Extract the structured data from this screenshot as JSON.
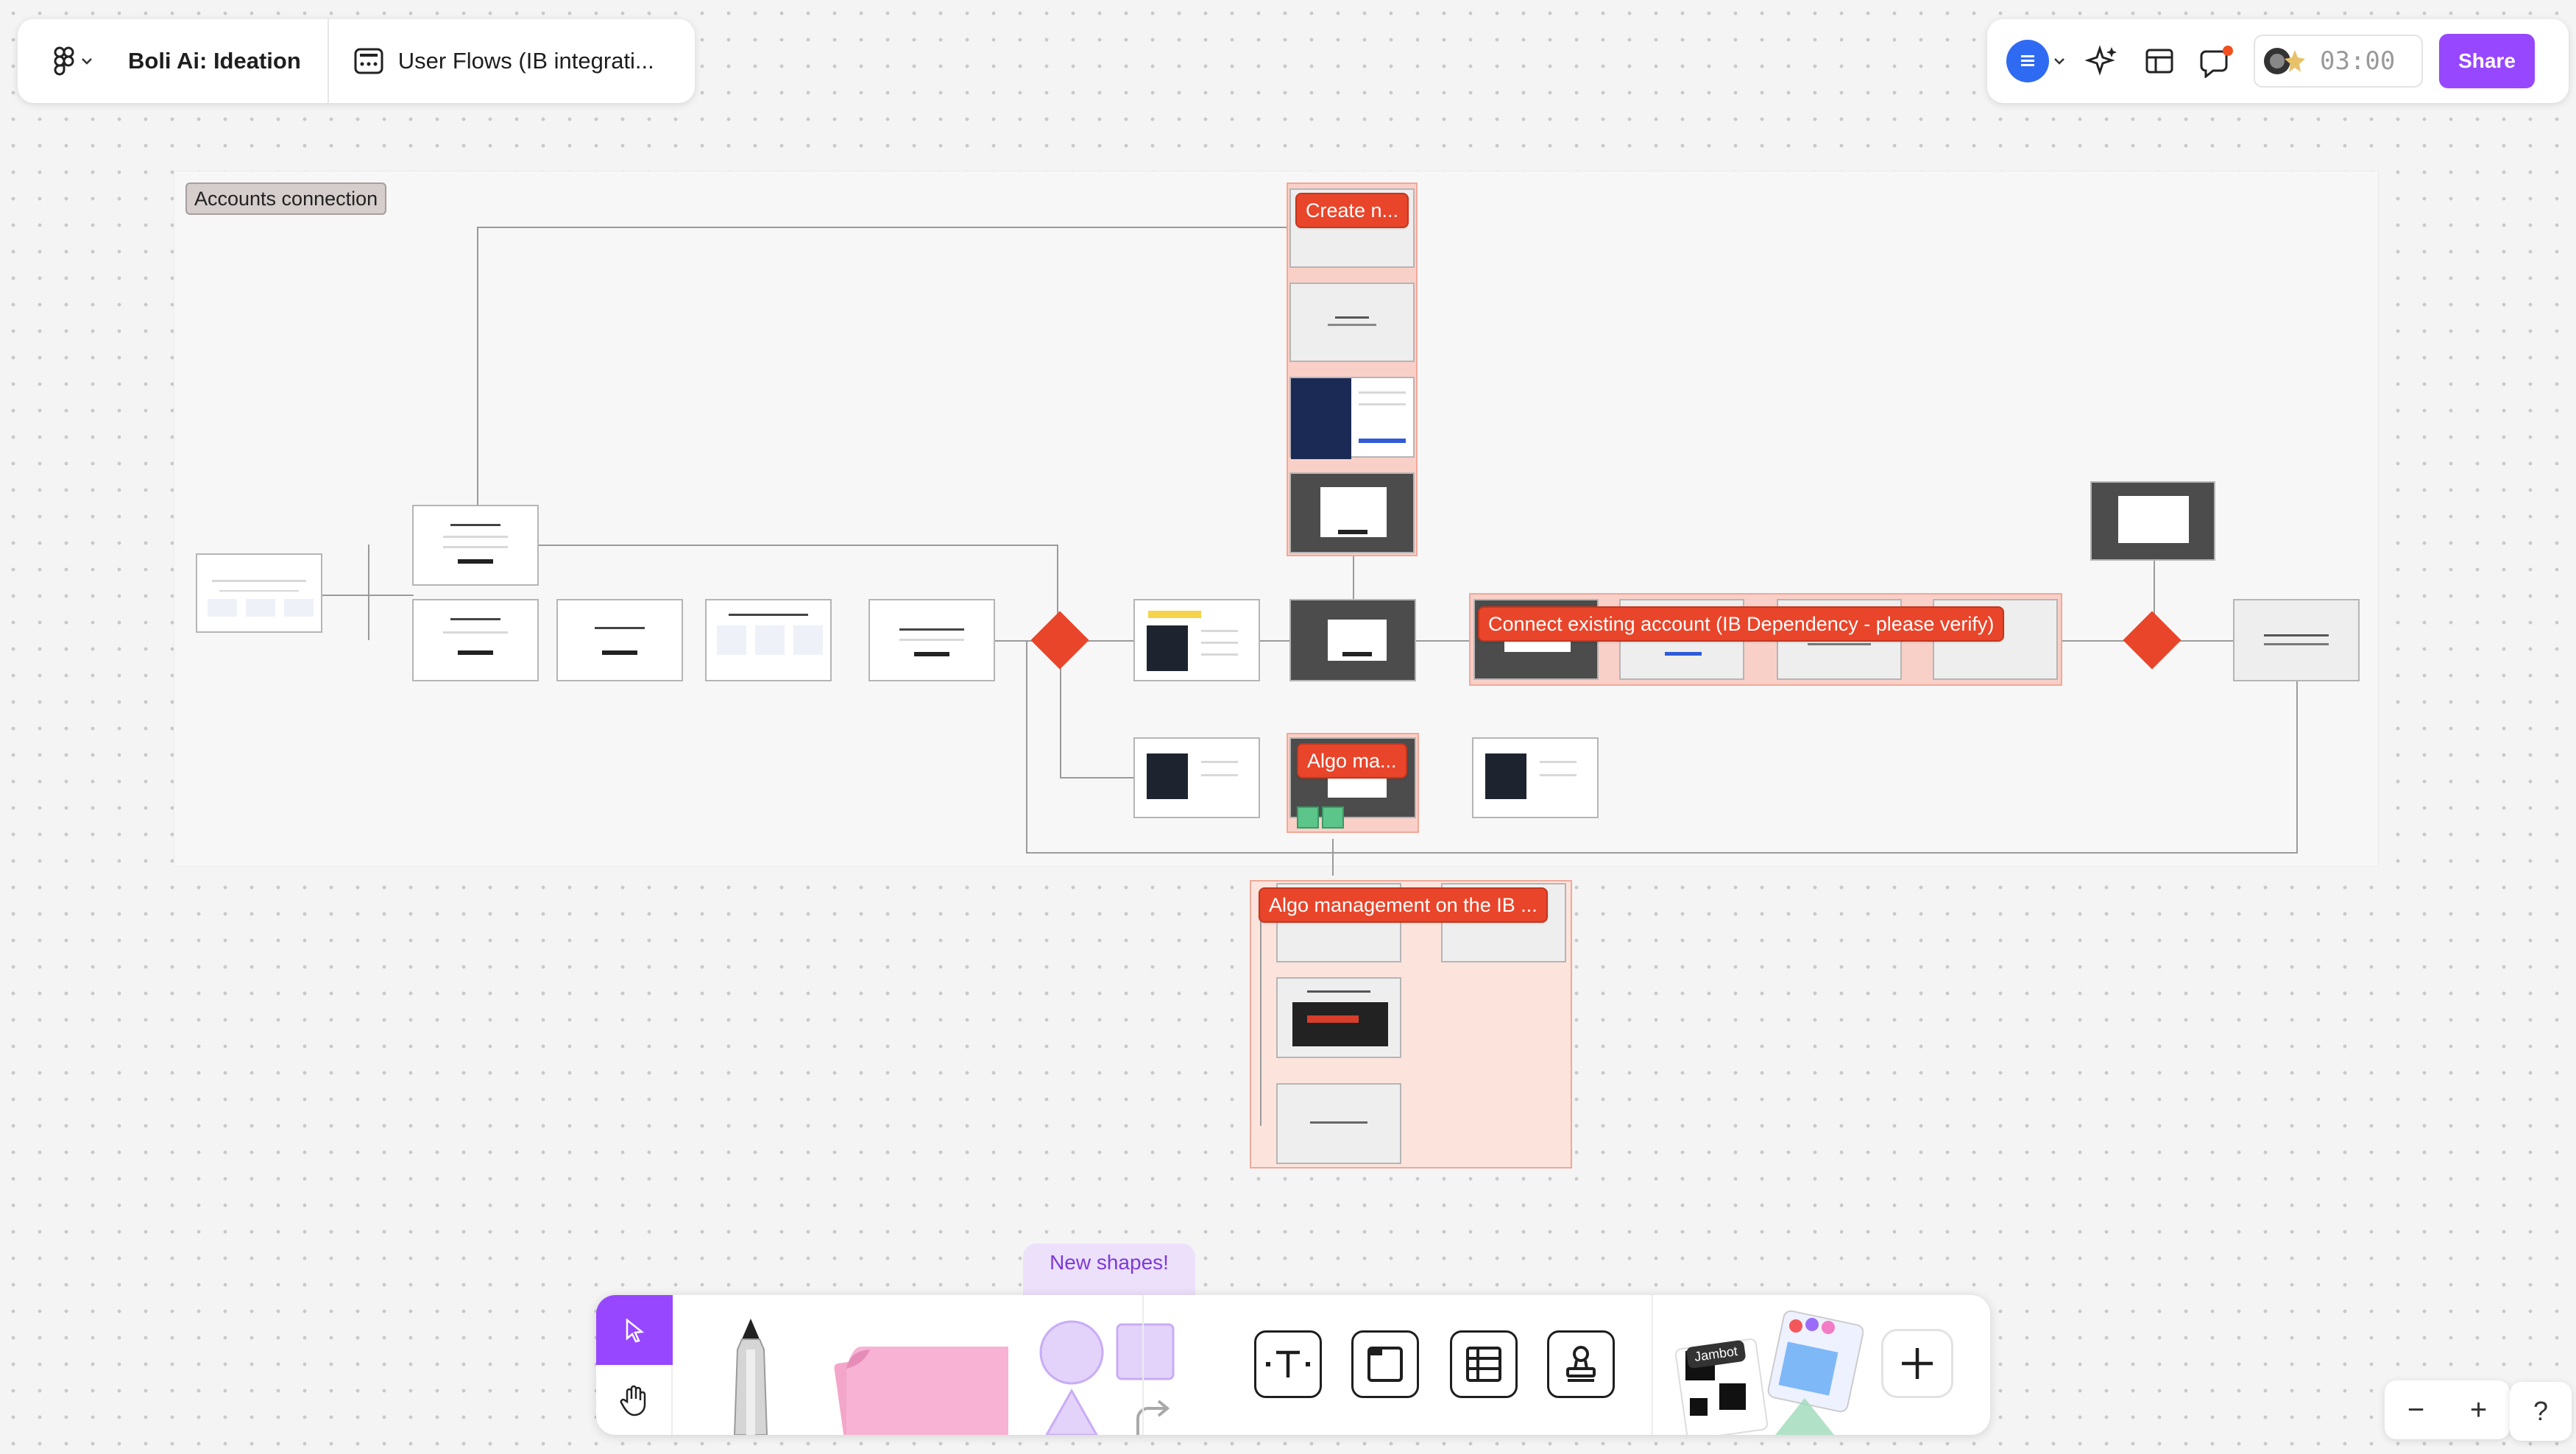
{
  "file": {
    "title": "Boli Ai: Ideation",
    "page_name": "User Flows (IB integrati..."
  },
  "toolbar_right": {
    "timer": "03:00",
    "share_label": "Share"
  },
  "canvas": {
    "section_label": "Accounts connection",
    "tags": {
      "create_new": "Create n...",
      "connect_existing": "Connect existing account (IB Dependency - please verify)",
      "algo_ma": "Algo ma...",
      "algo_management": "Algo management on the IB ..."
    }
  },
  "bottom_toolbar": {
    "new_shapes_label": "New shapes!",
    "jambot_label": "Jambot"
  },
  "zoom": {
    "minus": "−",
    "plus": "+",
    "help": "?"
  },
  "icons": [
    "figma-menu-icon",
    "chevron-down-icon",
    "page-icon",
    "list-icon",
    "ai-sparkle-icon",
    "layout-icon",
    "comment-icon",
    "avatar-icon",
    "share-button",
    "cursor-icon",
    "hand-icon",
    "pen-icon",
    "sticky-note-icon",
    "shapes-icon",
    "text-icon",
    "section-icon",
    "table-icon",
    "stamp-icon",
    "widgets-icon",
    "plus-icon"
  ],
  "colors": {
    "accent": "#9747ff",
    "tag_red": "#e8452a",
    "blue": "#2f6bf2"
  }
}
